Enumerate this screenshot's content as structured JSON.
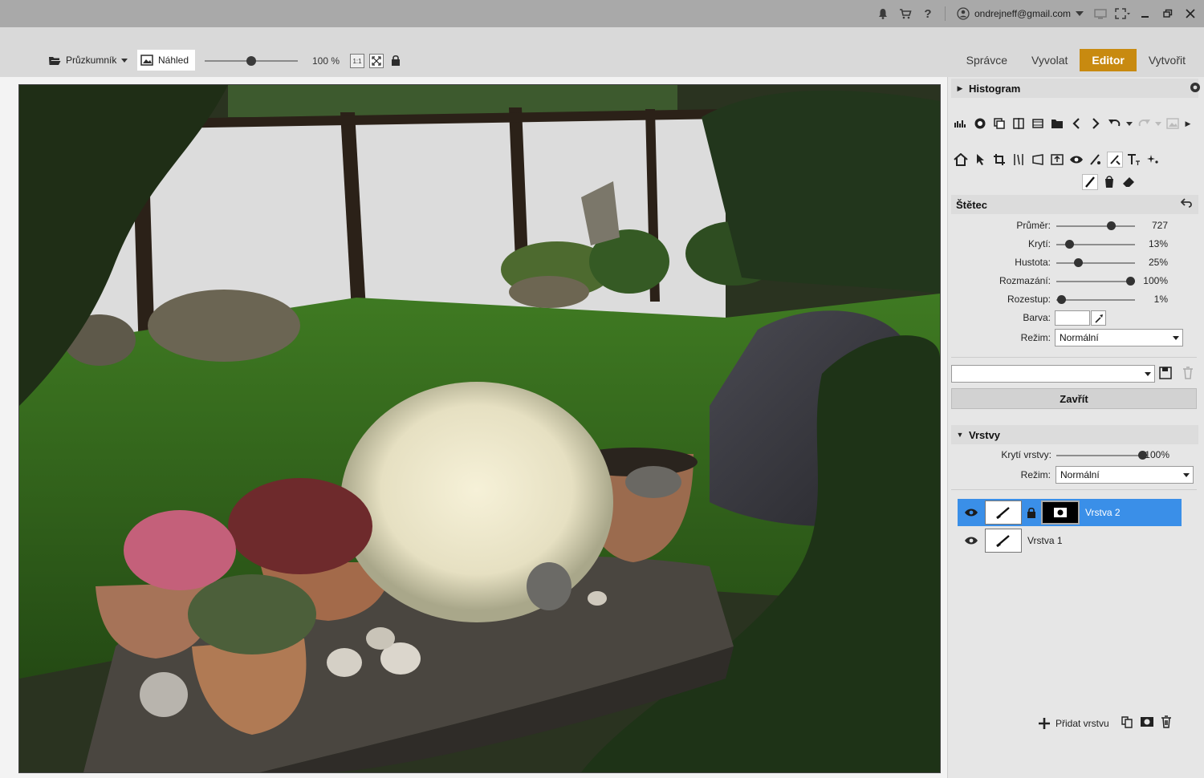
{
  "titlebar": {
    "user_email": "ondrejneff@gmail.com",
    "icons": [
      "bell-icon",
      "cart-icon",
      "help-icon",
      "user-icon",
      "monitor-icon",
      "fullscreen-icon",
      "minimize-icon",
      "restore-icon",
      "close-icon"
    ]
  },
  "toolbar": {
    "explorer_label": "Průzkumník",
    "preview_label": "Náhled",
    "zoom_value": "100 %",
    "zoom_fraction": 0.5,
    "one_to_one": "1:1"
  },
  "tabs": [
    {
      "label": "Správce",
      "active": false
    },
    {
      "label": "Vyvolat",
      "active": false
    },
    {
      "label": "Editor",
      "active": true
    },
    {
      "label": "Vytvořit",
      "active": false
    }
  ],
  "panel": {
    "histogram_title": "Histogram",
    "brush_title": "Štětec",
    "props": [
      {
        "label": "Průměr:",
        "value": "727",
        "fraction": 0.72
      },
      {
        "label": "Krytí:",
        "value": "13%",
        "fraction": 0.13
      },
      {
        "label": "Hustota:",
        "value": "25%",
        "fraction": 0.25
      },
      {
        "label": "Rozmazání:",
        "value": "100%",
        "fraction": 1.0
      },
      {
        "label": "Rozestup:",
        "value": "1%",
        "fraction": 0.01
      }
    ],
    "color_label": "Barva:",
    "mode_label": "Režim:",
    "mode_value": "Normální",
    "preset_value": "",
    "close_label": "Zavřít",
    "layers_title": "Vrstvy",
    "layer_opacity_label": "Krytí vrstvy:",
    "layer_opacity_value": "100%",
    "layer_opacity_fraction": 1.0,
    "layer_mode_label": "Režim:",
    "layer_mode_value": "Normální",
    "layers": [
      {
        "name": "Vrstva 2",
        "selected": true
      },
      {
        "name": "Vrstva 1",
        "selected": false
      }
    ],
    "add_layer_label": "Přidat vrstvu"
  }
}
